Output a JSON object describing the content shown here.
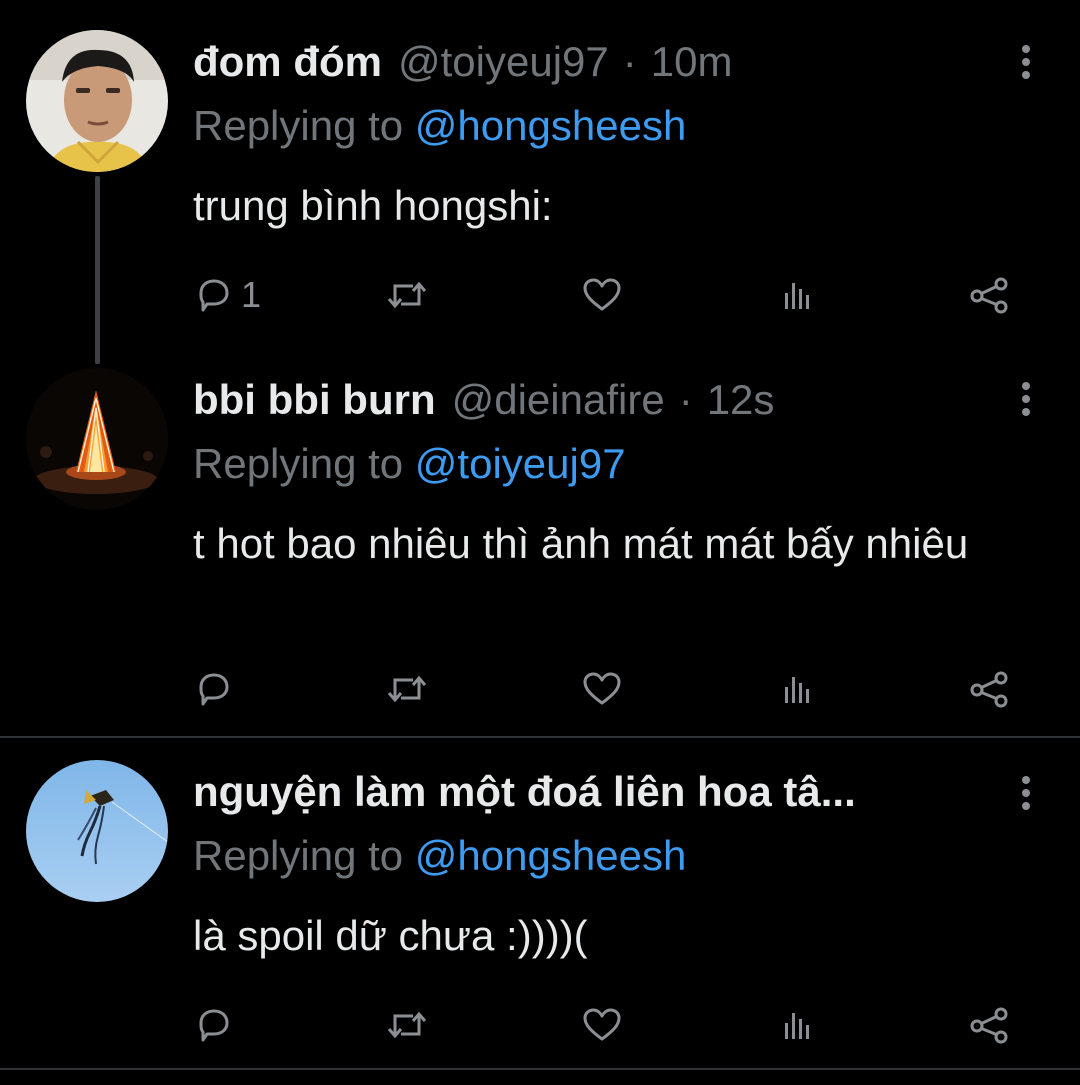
{
  "tweets": [
    {
      "name": "đom đóm",
      "handle": "@toiyeuj97",
      "time": "10m",
      "replying_prefix": "Replying to ",
      "replying_to": "@hongsheesh",
      "text": "trung bình hongshi:",
      "reply_count": "1",
      "avatar": "avatar-person-photo"
    },
    {
      "name": "bbi bbi burn",
      "handle": "@dieinafire",
      "time": "12s",
      "replying_prefix": "Replying to ",
      "replying_to": "@toiyeuj97",
      "text": "t hot bao nhiêu thì ảnh mát mát bấy nhiêu",
      "reply_count": "",
      "avatar": "avatar-bonfire-photo"
    },
    {
      "name": "nguyện làm một đoá liên hoa tâ...",
      "handle": "",
      "time": "",
      "replying_prefix": "Replying to ",
      "replying_to": "@hongsheesh",
      "text": "là spoil dữ chưa :))))(",
      "reply_count": "",
      "avatar": "avatar-kite-sky-photo"
    }
  ],
  "separator_dot": "·",
  "icons": [
    "reply-icon",
    "retweet-icon",
    "like-icon",
    "views-icon",
    "share-icon",
    "more-icon"
  ],
  "colors": {
    "background": "#000000",
    "text": "#e7e9ea",
    "muted": "#71767b",
    "link": "#3d9bf0",
    "thread_line": "#3e4144"
  }
}
